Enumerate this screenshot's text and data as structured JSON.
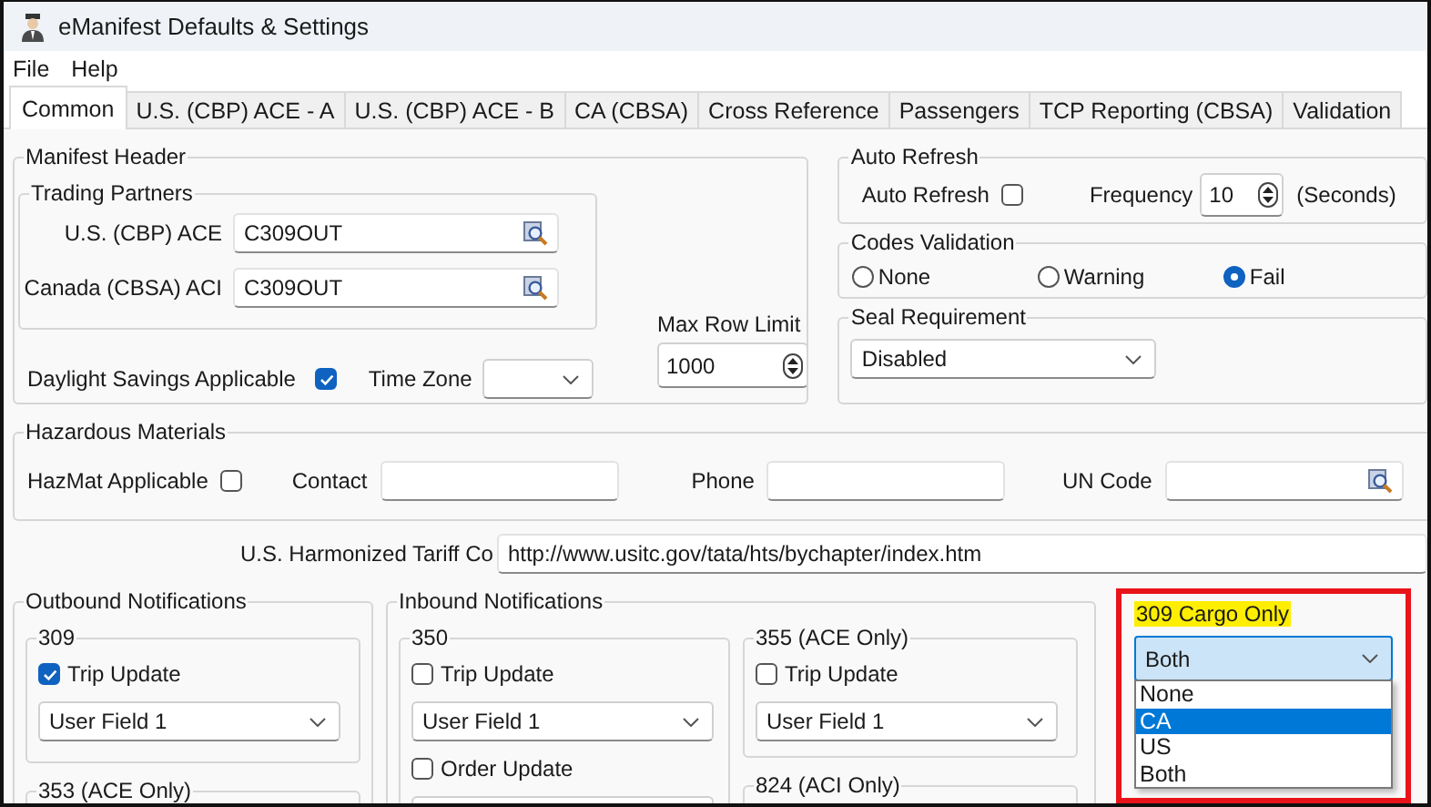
{
  "window": {
    "title": "eManifest Defaults & Settings"
  },
  "menu": [
    "File",
    "Help"
  ],
  "tabs": [
    {
      "label": "Common",
      "selected": true
    },
    {
      "label": "U.S. (CBP) ACE - A",
      "selected": false
    },
    {
      "label": "U.S. (CBP) ACE - B",
      "selected": false
    },
    {
      "label": "CA (CBSA)",
      "selected": false
    },
    {
      "label": "Cross Reference",
      "selected": false
    },
    {
      "label": "Passengers",
      "selected": false
    },
    {
      "label": "TCP Reporting (CBSA)",
      "selected": false
    },
    {
      "label": "Validation",
      "selected": false
    }
  ],
  "manifest_header": {
    "title": "Manifest Header",
    "trading_partners": {
      "title": "Trading Partners",
      "fields": [
        {
          "label": "U.S. (CBP) ACE",
          "value": "C309OUT"
        },
        {
          "label": "Canada (CBSA) ACI",
          "value": "C309OUT"
        }
      ]
    },
    "daylight_savings": {
      "label": "Daylight Savings Applicable",
      "checked": true
    },
    "time_zone": {
      "label": "Time Zone"
    },
    "max_row_limit": {
      "label": "Max Row Limit",
      "value": "1000"
    }
  },
  "auto_refresh": {
    "title": "Auto Refresh",
    "checkbox": {
      "label": "Auto Refresh",
      "checked": false
    },
    "frequency": {
      "label": "Frequency",
      "value": "10"
    },
    "unit": "(Seconds)"
  },
  "codes_validation": {
    "title": "Codes Validation",
    "options": [
      {
        "label": "None",
        "selected": false
      },
      {
        "label": "Warning",
        "selected": false
      },
      {
        "label": "Fail",
        "selected": true
      }
    ]
  },
  "seal_requirement": {
    "title": "Seal Requirement",
    "value": "Disabled"
  },
  "hazardous_materials": {
    "title": "Hazardous Materials",
    "hazmat": {
      "label": "HazMat Applicable",
      "checked": false
    },
    "fields": [
      {
        "label": "Contact",
        "kind": "text"
      },
      {
        "label": "Phone",
        "kind": "text"
      },
      {
        "label": "UN Code",
        "kind": "lookup"
      }
    ]
  },
  "tariff": {
    "label": "U.S. Harmonized Tariff Co",
    "value": "http://www.usitc.gov/tata/hts/bychapter/index.htm"
  },
  "outbound": {
    "title": "Outbound Notifications",
    "groups": [
      {
        "title": "309",
        "items": [
          {
            "kind": "checkbox",
            "label": "Trip Update",
            "checked": true
          },
          {
            "kind": "dropdown",
            "value": "User Field 1"
          }
        ]
      },
      {
        "title": "353 (ACE Only)"
      }
    ]
  },
  "inbound": {
    "title": "Inbound Notifications",
    "columns": [
      [
        {
          "title": "350",
          "items": [
            {
              "kind": "checkbox",
              "label": "Trip Update",
              "checked": false
            },
            {
              "kind": "dropdown",
              "value": "User Field 1"
            },
            {
              "kind": "checkbox",
              "label": "Order Update",
              "checked": false
            },
            {
              "kind": "dropdown"
            }
          ]
        }
      ],
      [
        {
          "title": "355 (ACE Only)",
          "items": [
            {
              "kind": "checkbox",
              "label": "Trip Update",
              "checked": false
            },
            {
              "kind": "dropdown",
              "value": "User Field 1"
            }
          ]
        },
        {
          "title": "824 (ACI Only)"
        }
      ]
    ]
  },
  "cargo_only": {
    "title": "309 Cargo Only",
    "value": "Both",
    "options": [
      {
        "label": "None",
        "highlighted": false
      },
      {
        "label": "CA",
        "highlighted": true
      },
      {
        "label": "US",
        "highlighted": false
      },
      {
        "label": "Both",
        "highlighted": false
      }
    ]
  }
}
